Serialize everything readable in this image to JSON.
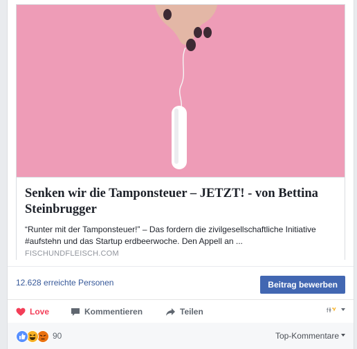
{
  "link": {
    "title": "Senken wir die Tamponsteuer – JETZT! - von Bettina Steinbrugger",
    "description": "“Runter mit der Tamponsteuer!” – Das fordern die zivilgesellschaftliche Initiative #aufstehn und das Startup erdbeerwoche. Den Appell an ...",
    "domain": "FISCHUNDFLEISCH.COM"
  },
  "insights": {
    "reach": "12.628 erreichte Personen",
    "boost_label": "Beitrag bewerben"
  },
  "actions": {
    "love_label": "Love",
    "comment_label": "Kommentieren",
    "share_label": "Teilen"
  },
  "reactions": {
    "count": "90",
    "icons": [
      "like-icon",
      "haha-icon",
      "angry-icon"
    ],
    "sort_label": "Top-Kommentare"
  },
  "colors": {
    "accent": "#4267b2",
    "link": "#365899",
    "love": "#f33e58",
    "image_background": "#ee9cb7"
  }
}
